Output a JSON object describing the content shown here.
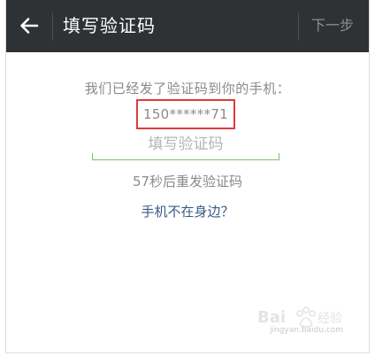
{
  "header": {
    "title": "填写验证码",
    "next_label": "下一步",
    "back_icon": "back-arrow-icon"
  },
  "verify": {
    "sent_message": "我们已经发了验证码到你的手机：",
    "phone_number": "150******71",
    "code_input": {
      "value": "",
      "placeholder": "填写验证码"
    },
    "countdown_text": "57秒后重发验证码",
    "not_near_phone_link": "手机不在身边？"
  },
  "watermark": {
    "brand": "Baidu 经验",
    "url": "jingyan.baidu.com"
  },
  "colors": {
    "topbar": "#2e3235",
    "highlight_box": "#e03a3a",
    "input_underline": "#7ac46a",
    "link": "#3a5b86"
  }
}
